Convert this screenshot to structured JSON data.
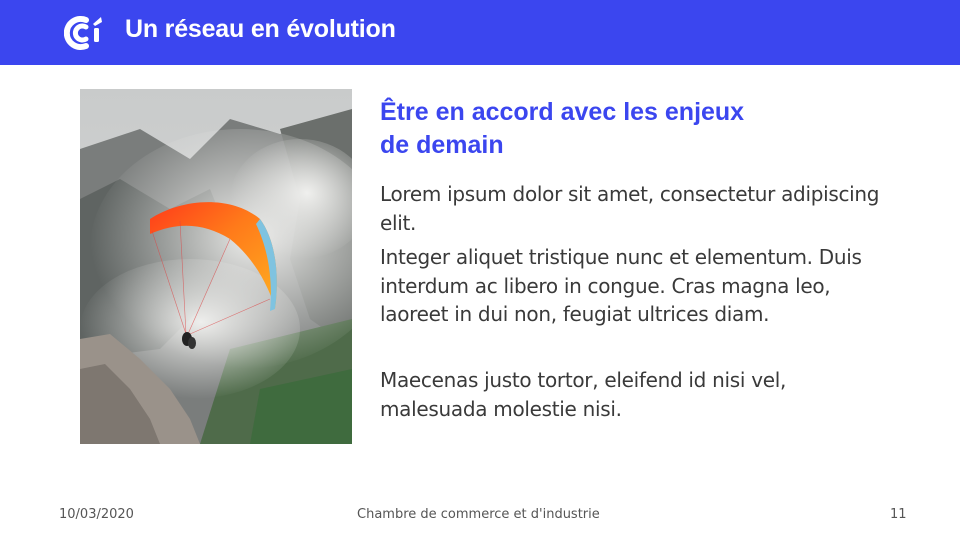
{
  "header": {
    "title": "Un réseau en évolution",
    "color": "#3b46ef",
    "logo_icon": "cci-logo-icon"
  },
  "content": {
    "image_description_icon": "paraglider-photo",
    "subtitle_line1": "Être en accord avec les enjeux",
    "subtitle_line2": "de demain",
    "paragraphs": [
      "Lorem ipsum dolor sit amet, consectetur adipiscing elit.",
      "Integer aliquet tristique nunc et elementum. Duis interdum ac libero in congue. Cras magna leo, laoreet in dui non, feugiat ultrices diam.",
      "Maecenas justo tortor, eleifend id nisi vel, malesuada molestie nisi."
    ]
  },
  "footer": {
    "date": "10/03/2020",
    "organization": "Chambre de commerce et d'industrie",
    "page_number": "11"
  }
}
